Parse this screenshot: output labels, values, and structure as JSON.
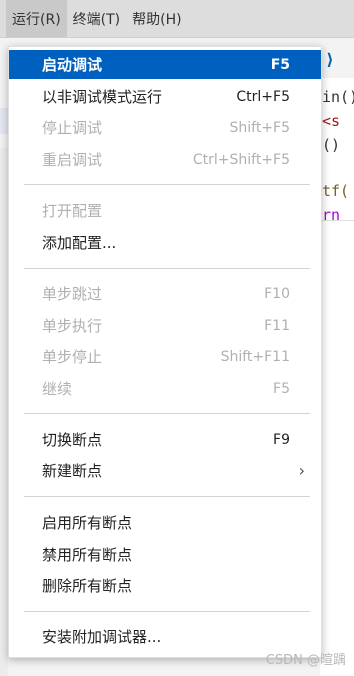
{
  "menubar": {
    "items": [
      {
        "label": "运行(R)"
      },
      {
        "label": "终端(T)"
      },
      {
        "label": "帮助(H)"
      }
    ]
  },
  "editor": {
    "lines": [
      "in()",
      "<s",
      "()",
      "tf(",
      "rn"
    ]
  },
  "menu": {
    "items": [
      {
        "label": "启动调试",
        "shortcut": "F5"
      },
      {
        "label": "以非调试模式运行",
        "shortcut": "Ctrl+F5"
      },
      {
        "label": "停止调试",
        "shortcut": "Shift+F5"
      },
      {
        "label": "重启调试",
        "shortcut": "Ctrl+Shift+F5"
      },
      {
        "label": "打开配置",
        "shortcut": ""
      },
      {
        "label": "添加配置...",
        "shortcut": ""
      },
      {
        "label": "单步跳过",
        "shortcut": "F10"
      },
      {
        "label": "单步执行",
        "shortcut": "F11"
      },
      {
        "label": "单步停止",
        "shortcut": "Shift+F11"
      },
      {
        "label": "继续",
        "shortcut": "F5"
      },
      {
        "label": "切换断点",
        "shortcut": "F9"
      },
      {
        "label": "新建断点",
        "shortcut": ""
      },
      {
        "label": "启用所有断点",
        "shortcut": ""
      },
      {
        "label": "禁用所有断点",
        "shortcut": ""
      },
      {
        "label": "删除所有断点",
        "shortcut": ""
      },
      {
        "label": "安装附加调试器...",
        "shortcut": ""
      }
    ]
  },
  "watermark": "CSDN @暄踽",
  "colors": {
    "selected": "#0060c0",
    "disabled_text": "#b0b0b0",
    "enabled_text": "#222222"
  },
  "icons": {
    "submenu": "chevron-right-icon",
    "vscode_tab": "vscode-icon"
  }
}
